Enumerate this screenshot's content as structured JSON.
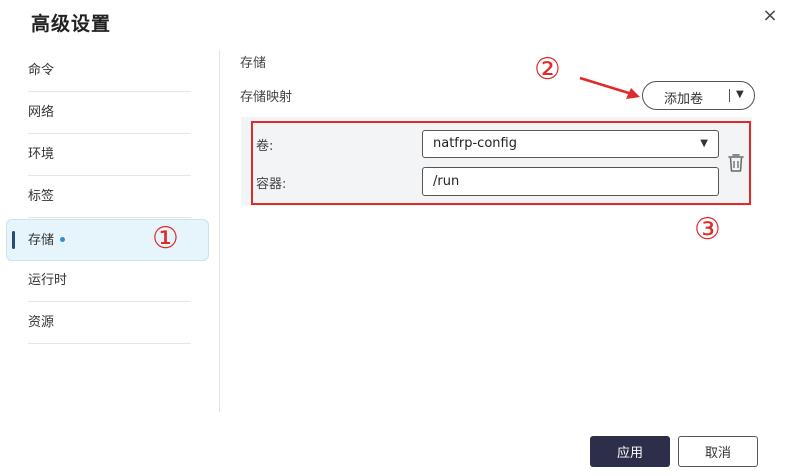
{
  "dialog": {
    "title": "高级设置",
    "close_icon": "×"
  },
  "sidebar": {
    "items": [
      {
        "label": "命令"
      },
      {
        "label": "网络"
      },
      {
        "label": "环境"
      },
      {
        "label": "标签"
      },
      {
        "label": "存储",
        "active": true,
        "has_indicator_dot": true
      },
      {
        "label": "运行时"
      },
      {
        "label": "资源"
      }
    ]
  },
  "content": {
    "section_title": "存储",
    "mapping_title": "存储映射",
    "add_volume_label": "添加卷",
    "mapping": {
      "volume_label": "卷:",
      "volume_value": "natfrp-config",
      "container_label": "容器:",
      "container_value": "/run"
    }
  },
  "annotations": {
    "one": "①",
    "two": "②",
    "three": "③",
    "color": "#e02a2a"
  },
  "footer": {
    "apply_label": "应用",
    "cancel_label": "取消"
  },
  "colors": {
    "primary_button": "#2d2e4a",
    "active_nav_bg": "#e6f4fb",
    "indicator_dot": "#2b8fd1"
  }
}
